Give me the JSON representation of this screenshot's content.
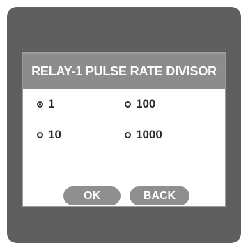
{
  "dialog": {
    "title": "RELAY-1 PULSE RATE DIVISOR",
    "options": [
      {
        "label": "1",
        "selected": true
      },
      {
        "label": "100",
        "selected": false
      },
      {
        "label": "10",
        "selected": false
      },
      {
        "label": "1000",
        "selected": false
      }
    ],
    "ok_label": "OK",
    "back_label": "BACK"
  },
  "colors": {
    "screen_bg": "#5f5f5f",
    "title_bg": "#8c8c8c",
    "button_bg": "#8f8f8f",
    "text": "#2a2a2a"
  }
}
